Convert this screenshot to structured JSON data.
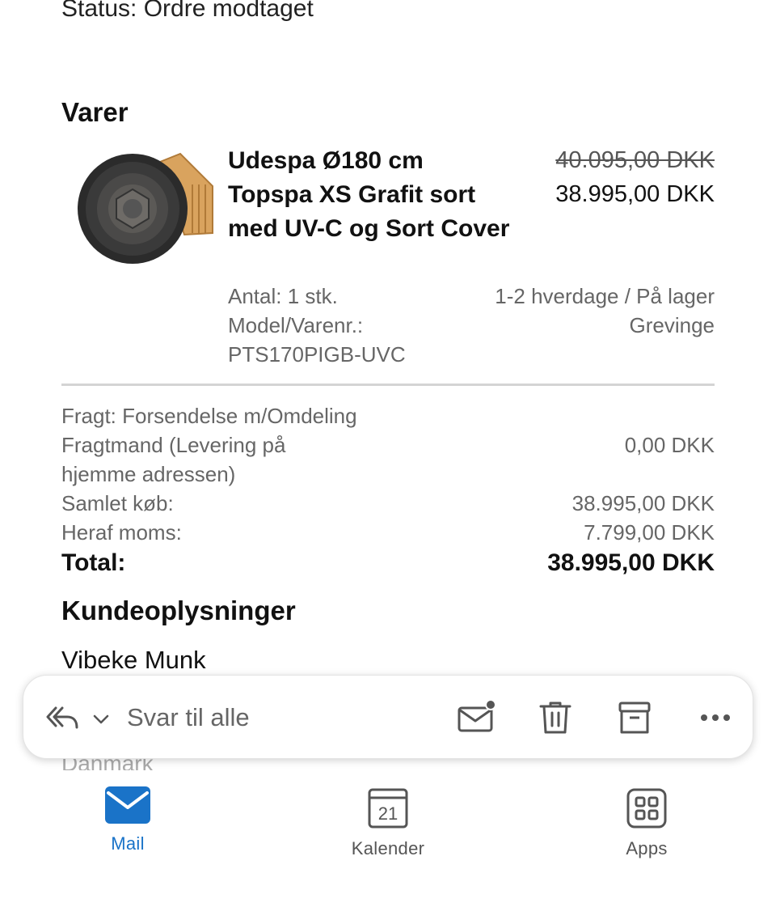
{
  "order": {
    "status_text": "Status: Ordre modtaget",
    "items_heading": "Varer",
    "product": {
      "title": "Udespa Ø180 cm Topspa XS Grafit sort med UV-C og Sort Cover",
      "price_original": "40.095,00 DKK",
      "price_current": "38.995,00 DKK",
      "quantity": "Antal: 1 stk.",
      "model_label": "Model/Varenr.:",
      "model_number": "PTS170PIGB-UVC",
      "delivery": "1-2 hverdage / På lager",
      "location": "Grevinge"
    },
    "summary": {
      "shipping_label": "Fragt: Forsendelse m/Omdeling",
      "carrier_label": "Fragtmand (Levering på hjemme adressen)",
      "carrier_price": "0,00 DKK",
      "subtotal_label": "Samlet køb:",
      "subtotal_value": "38.995,00 DKK",
      "vat_label": "Heraf moms:",
      "vat_value": "7.799,00 DKK",
      "total_label": "Total:",
      "total_value": "38.995,00 DKK"
    },
    "customer_heading": "Kundeoplysninger",
    "customer_name": "Vibeke Munk",
    "customer_country": "Danmark"
  },
  "action_bar": {
    "reply_all_label": "Svar til alle",
    "icons": [
      "reply-all-icon",
      "chevron-down-icon",
      "mark-unread-icon",
      "trash-icon",
      "archive-icon",
      "more-icon"
    ]
  },
  "tabbar": {
    "tabs": [
      {
        "label": "Mail",
        "icon": "mail-icon",
        "active": true
      },
      {
        "label": "Kalender",
        "icon": "calendar-icon",
        "date": "21",
        "active": false
      },
      {
        "label": "Apps",
        "icon": "apps-icon",
        "active": false
      }
    ]
  },
  "colors": {
    "accent": "#1a73c8",
    "text_primary": "#111111",
    "text_secondary": "#666666",
    "divider": "#d4d4d4"
  }
}
